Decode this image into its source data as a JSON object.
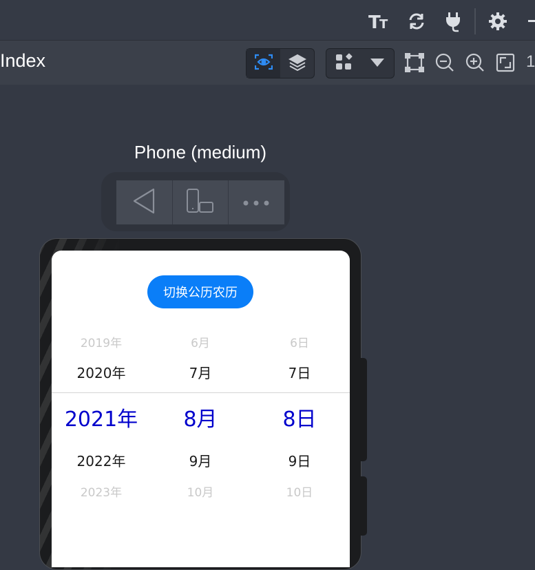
{
  "toolbar": {
    "icons": [
      "text-size-icon",
      "refresh-icon",
      "plug-icon",
      "gear-icon",
      "minimize-icon"
    ]
  },
  "title_bar": {
    "title": "Index",
    "trailing_digit": "1",
    "view_icons": [
      "eye-scan-icon",
      "layers-icon"
    ],
    "component_icons": [
      "widgets-icon",
      "dropdown-arrow-icon"
    ],
    "tool_icons": [
      "frame-icon",
      "zoom-out-icon",
      "zoom-in-icon",
      "fit-screen-icon"
    ]
  },
  "device": {
    "label": "Phone (medium)",
    "controls": [
      "back-icon",
      "rotate-device-icon",
      "more-icon"
    ]
  },
  "app": {
    "toggle_label": "切换公历农历",
    "picker": {
      "years": [
        "2019年",
        "2020年",
        "2021年",
        "2022年",
        "2023年"
      ],
      "months": [
        "6月",
        "7月",
        "8月",
        "9月",
        "10月"
      ],
      "days": [
        "6日",
        "7日",
        "8日",
        "9日",
        "10日"
      ],
      "selected": {
        "year": "2021年",
        "month": "8月",
        "day": "8日"
      },
      "selected_color": "#0000cc"
    },
    "accent": "#0a7ef8"
  }
}
